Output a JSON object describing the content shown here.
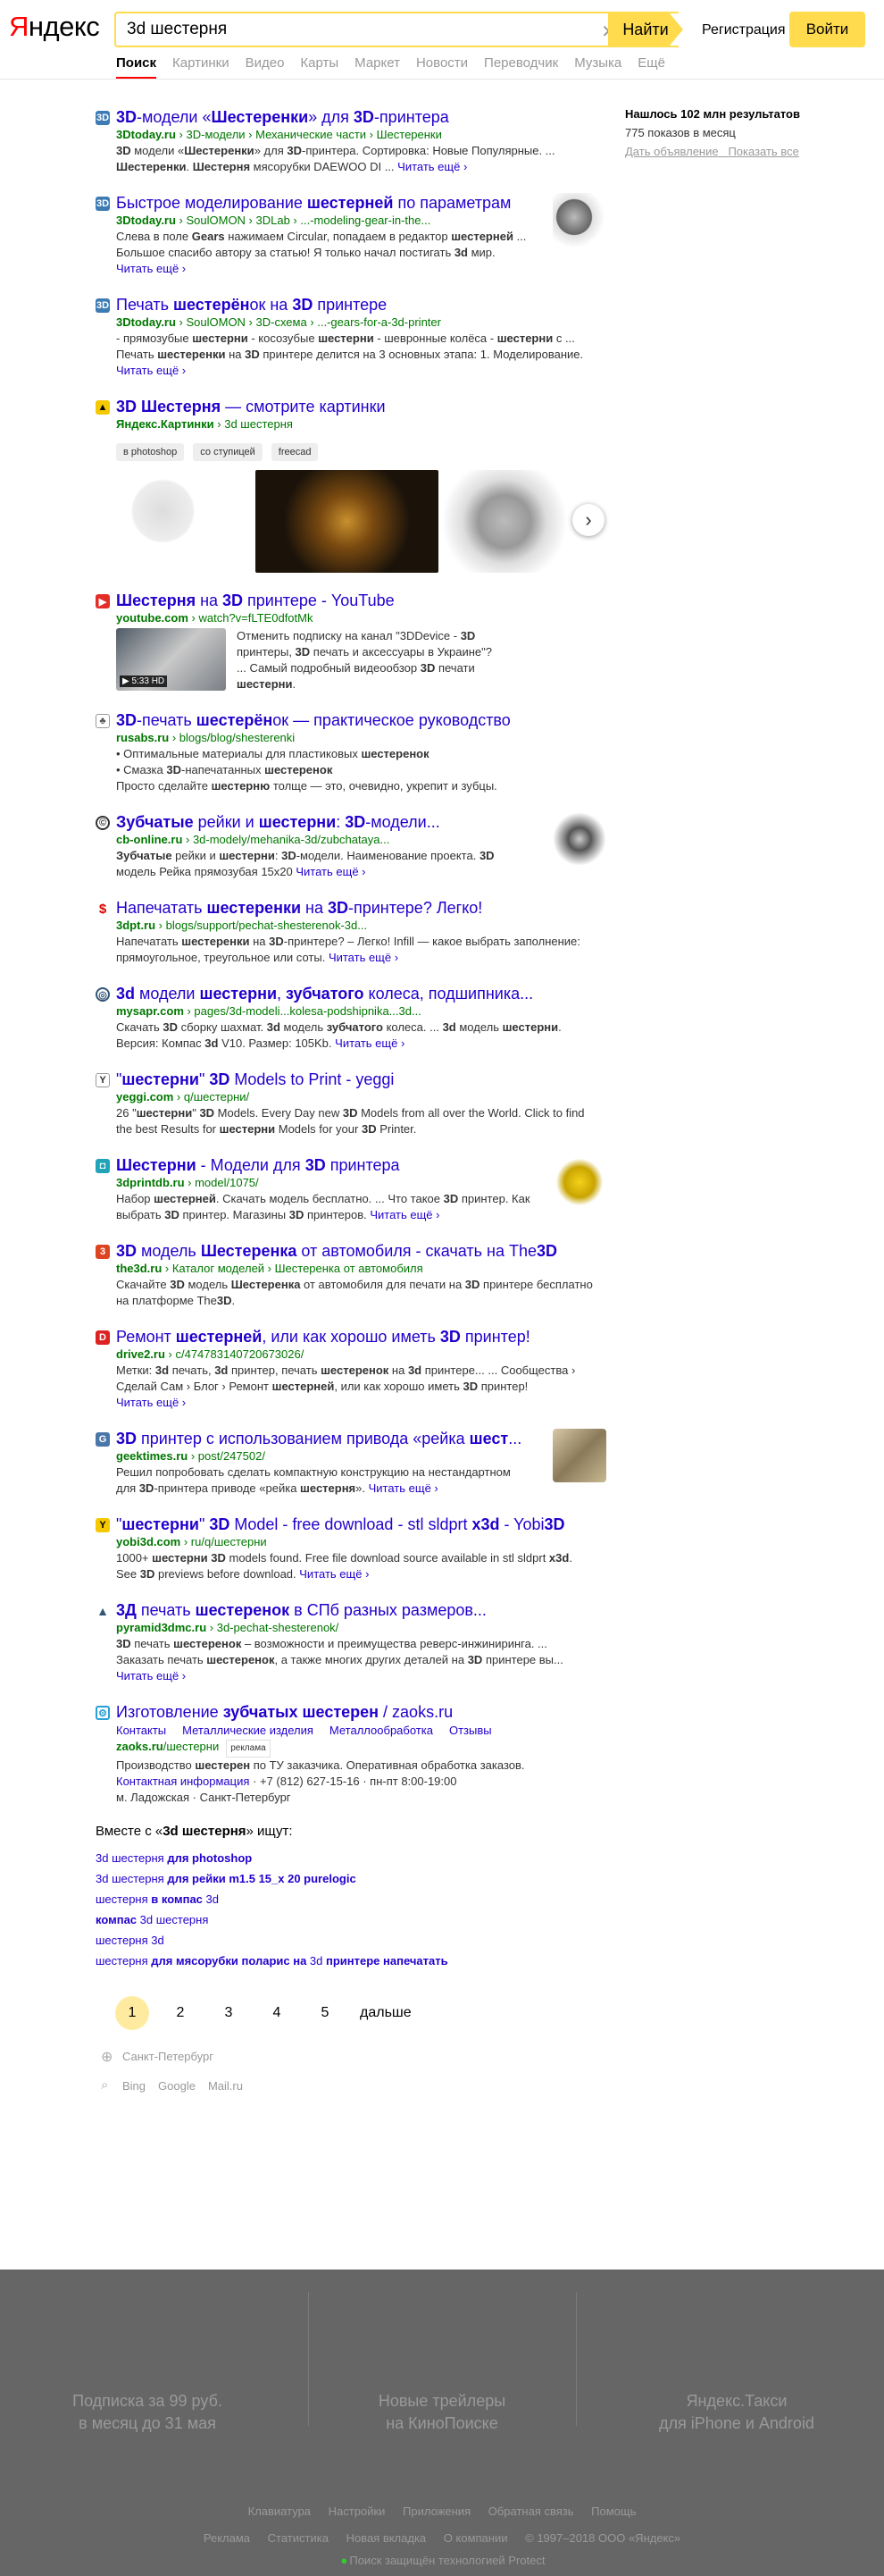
{
  "header": {
    "logo_a": "Я",
    "logo_b": "ндекс",
    "query": "3d шестерня",
    "search_btn": "Найти",
    "register": "Регистрация",
    "login": "Войти"
  },
  "tabs": [
    "Поиск",
    "Картинки",
    "Видео",
    "Карты",
    "Маркет",
    "Новости",
    "Переводчик",
    "Музыка",
    "Ещё"
  ],
  "sidebar": {
    "found": "Нашлось 102 млн результатов",
    "impressions": "775 показов в месяц",
    "ad_link": "Дать объявление",
    "show_all": "Показать все"
  },
  "results": [
    {
      "title_html": "<b>3D</b>-модели «<b>Шестеренки</b>» для <b>3D</b>-принтера",
      "url_html": "<b>3Dtoday.ru</b> › 3D-модели › Механические части › Шестеренки",
      "snippet_html": "<b>3D</b> модели «<b>Шестеренки</b>» для <b>3D</b>-принтера. Сортировка: Новые Популярные. ... <b>Шестеренки</b>. <b>Шестерня</b> мясорубки DAEWOO DI ...",
      "more": "Читать ещё"
    },
    {
      "title_html": "Быстрое моделирование <b>шестерней</b> по параметрам",
      "url_html": "<b>3Dtoday.ru</b> › SoulOMON › 3DLab › ...-modeling-gear-in-the...",
      "snippet_html": "Слева в поле <b>Gears</b> нажимаем Circular, попадаем в редактор <b>шестерней</b> ... Большое спасибо автору за статью! Я только начал постигать <b>3d</b> мир.",
      "more": "Читать ещё"
    },
    {
      "title_html": "Печать <b>шестерён</b>ок на <b>3D</b> принтере",
      "url_html": "<b>3Dtoday.ru</b> › SoulOMON › 3D-схема › ...-gears-for-a-3d-printer",
      "snippet_html": "- прямозубые <b>шестерни</b> - косозубые <b>шестерни</b> - шевронные колёса - <b>шестерни</b> с ... Печать <b>шестеренки</b> на <b>3D</b> принтере делится на 3 основных этапа: 1. Моделирование.",
      "more": "Читать ещё"
    },
    {
      "title_html": "<b>3D Шестерня</b> — смотрите картинки",
      "url_html": "<b>Яндекс.Картинки</b> › 3d шестерня",
      "chips": [
        "в photoshop",
        "со ступицей",
        "freecad"
      ]
    },
    {
      "title_html": "<b>Шестерня</b> на <b>3D</b> принтере - YouTube",
      "url_html": "<b>youtube.com</b> › watch?v=fLTE0dfotMk",
      "snippet_html": "Отменить подписку на канал \"3DDevice - <b>3D</b> принтеры, <b>3D</b> печать и аксессуары в Украине\"? ... Самый подробный видеообзор <b>3D</b> печати <b>шестерни</b>.",
      "badge": "▶ 5:33 HD"
    },
    {
      "title_html": "<b>3D</b>-печать <b>шестерён</b>ок — практическое руководство",
      "url_html": "<b>rusabs.ru</b> › blogs/blog/shesterenki",
      "bullets_html": [
        "Оптимальные материалы для пластиковых <b>шестеренок</b>",
        "Смазка <b>3D</b>-напечатанных <b>шестеренок</b>"
      ],
      "snippet_html": "Просто сделайте <b>шестерню</b> толще — это, очевидно, укрепит и зубцы."
    },
    {
      "title_html": "<b>Зубчатые</b> рейки и <b>шестерни</b>: <b>3D</b>-модели...",
      "url_html": "<b>cb-online.ru</b> › 3d-modely/mehanika-3d/zubchataya...",
      "snippet_html": "<b>Зубчатые</b> рейки и <b>шестерни</b>: <b>3D</b>-модели. Наименование проекта. <b>3D</b> модель Рейка прямозубая 15x20",
      "more": "Читать ещё"
    },
    {
      "title_html": "Напечатать <b>шестеренки</b> на <b>3D</b>-принтере? Легко!",
      "url_html": "<b>3dpt.ru</b> › blogs/support/pechat-shesterenok-3d...",
      "snippet_html": "Напечатать <b>шестеренки</b> на <b>3D</b>-принтере? – Легко! Infill — какое выбрать заполнение: прямоугольное, треугольное или соты.",
      "more": "Читать ещё"
    },
    {
      "title_html": "<b>3d</b> модели <b>шестерни</b>, <b>зубчатого</b> колеса, подшипника...",
      "url_html": "<b>mysapr.com</b> › pages/3d-modeli...kolesa-podshipnika...3d...",
      "snippet_html": "Скачать <b>3D</b> сборку шахмат. <b>3d</b> модель <b>зубчатого</b> колеса. ... <b>3d</b> модель <b>шестерни</b>. Версия: Компас <b>3d</b> V10. Размер: 105Kb.",
      "more": "Читать ещё"
    },
    {
      "title_html": "\"<b>шестерни</b>\" <b>3D</b> Models to Print - yeggi",
      "url_html": "<b>yeggi.com</b> › q/шестерни/",
      "snippet_html": "26 \"<b>шестерни</b>\" <b>3D</b> Models. Every Day new <b>3D</b> Models from all over the World. Click to find the best Results for <b>шестерни</b> Models for your <b>3D</b> Printer."
    },
    {
      "title_html": "<b>Шестерни</b> - Модели для <b>3D</b> принтера",
      "url_html": "<b>3dprintdb.ru</b> › model/1075/",
      "snippet_html": "Набор <b>шестерней</b>. Скачать модель бесплатно. ... Что такое <b>3D</b> принтер. Как выбрать <b>3D</b> принтер. Магазины <b>3D</b> принтеров.",
      "more": "Читать ещё"
    },
    {
      "title_html": "<b>3D</b> модель <b>Шестеренка</b> от автомобиля - скачать на The<b>3D</b>",
      "url_html": "<b>the3d.ru</b> › Каталог моделей › Шестеренка от автомобиля",
      "snippet_html": "Скачайте <b>3D</b> модель <b>Шестеренка</b> от автомобиля для печати на <b>3D</b> принтере бесплатно на платформе The<b>3D</b>."
    },
    {
      "title_html": "Ремонт <b>шестерней</b>, или как хорошо иметь <b>3D</b> принтер!",
      "url_html": "<b>drive2.ru</b> › c/474783140720673026/",
      "snippet_html": "Метки: <b>3d</b> печать, <b>3d</b> принтер, печать <b>шестеренок</b> на <b>3d</b> принтере... ... Сообщества › Сделай Сам › Блог › Ремонт <b>шестерней</b>, или как хорошо иметь <b>3D</b> принтер!",
      "more": "Читать ещё"
    },
    {
      "title_html": "<b>3D</b> принтер с использованием привода «рейка <b>шест</b>...",
      "url_html": "<b>geektimes.ru</b> › post/247502/",
      "snippet_html": "Решил попробовать сделать компактную конструкцию на нестандартном для <b>3D</b>-принтера приводе «рейка <b>шестерня</b>».",
      "more": "Читать ещё"
    },
    {
      "title_html": "\"<b>шестерни</b>\" <b>3D</b> Model - free download - stl sldprt <b>x3d</b> - Yobi<b>3D</b>",
      "url_html": "<b>yobi3d.com</b> › ru/q/шестерни",
      "snippet_html": "1000+ <b>шестерни</b> <b>3D</b> models found. Free file download source available in stl sldprt <b>x3d</b>. See <b>3D</b> previews before download.",
      "more": "Читать ещё"
    },
    {
      "title_html": "<b>3Д</b> печать <b>шестеренок</b> в СПб разных размеров...",
      "url_html": "<b>pyramid3dmc.ru</b> › 3d-pechat-shesterenok/",
      "snippet_html": "<b>3D</b> печать <b>шестеренок</b> – возможности и преимущества реверс-инжиниринга. ... Заказать печать <b>шестеренок</b>, а также многих других деталей на <b>3D</b> принтере вы...",
      "more": "Читать ещё"
    },
    {
      "title_html": "Изготовление <b>зубчатых шестерен</b> / zaoks.ru",
      "adlinks": [
        "Контакты",
        "Металлические изделия",
        "Металлообработка",
        "Отзывы"
      ],
      "url_html": "<b>zaoks.ru</b>/шестерни",
      "ad_label": "реклама",
      "snippet_html": "Производство <b>шестерен</b> по ТУ заказчика. Оперативная обработка заказов.",
      "contact": "Контактная информация",
      "phone": "· +7 (812) 627-15-16 · пн-пт 8:00-19:00",
      "address": "м. Ладожская · Санкт-Петербург"
    }
  ],
  "also": {
    "heading_html": "Вместе с «<b>3d шестерня</b>» ищут:",
    "links_html": [
      "3d шестерня <b>для photoshop</b>",
      "3d шестерня <b>для рейки m1.5 15_x 20 purelogic</b>",
      "шестерня <b>в компас</b> 3d",
      "<b>компас</b> 3d шестерня",
      "шестерня 3d",
      "шестерня <b>для мясорубки поларис на</b> 3d <b>принтере напечатать</b>"
    ]
  },
  "pager": {
    "pages": [
      "1",
      "2",
      "3",
      "4",
      "5"
    ],
    "next": "дальше"
  },
  "region": "Санкт-Петербург",
  "engines": [
    "Bing",
    "Google",
    "Mail.ru"
  ],
  "footer": {
    "promo1": [
      "Подписка за 99 руб.",
      "в месяц до 31 мая"
    ],
    "promo2": [
      "Новые трейлеры",
      "на КиноПоиске"
    ],
    "promo3": [
      "Яндекс.Такси",
      "для iPhone и Android"
    ],
    "links1": [
      "Клавиатура",
      "Настройки",
      "Приложения",
      "Обратная связь",
      "Помощь"
    ],
    "links2": [
      "Реклама",
      "Статистика",
      "Новая вкладка",
      "О компании",
      "© 1997–2018 ООО «Яндекс»"
    ],
    "protect": "Поиск защищён технологией Protect"
  }
}
